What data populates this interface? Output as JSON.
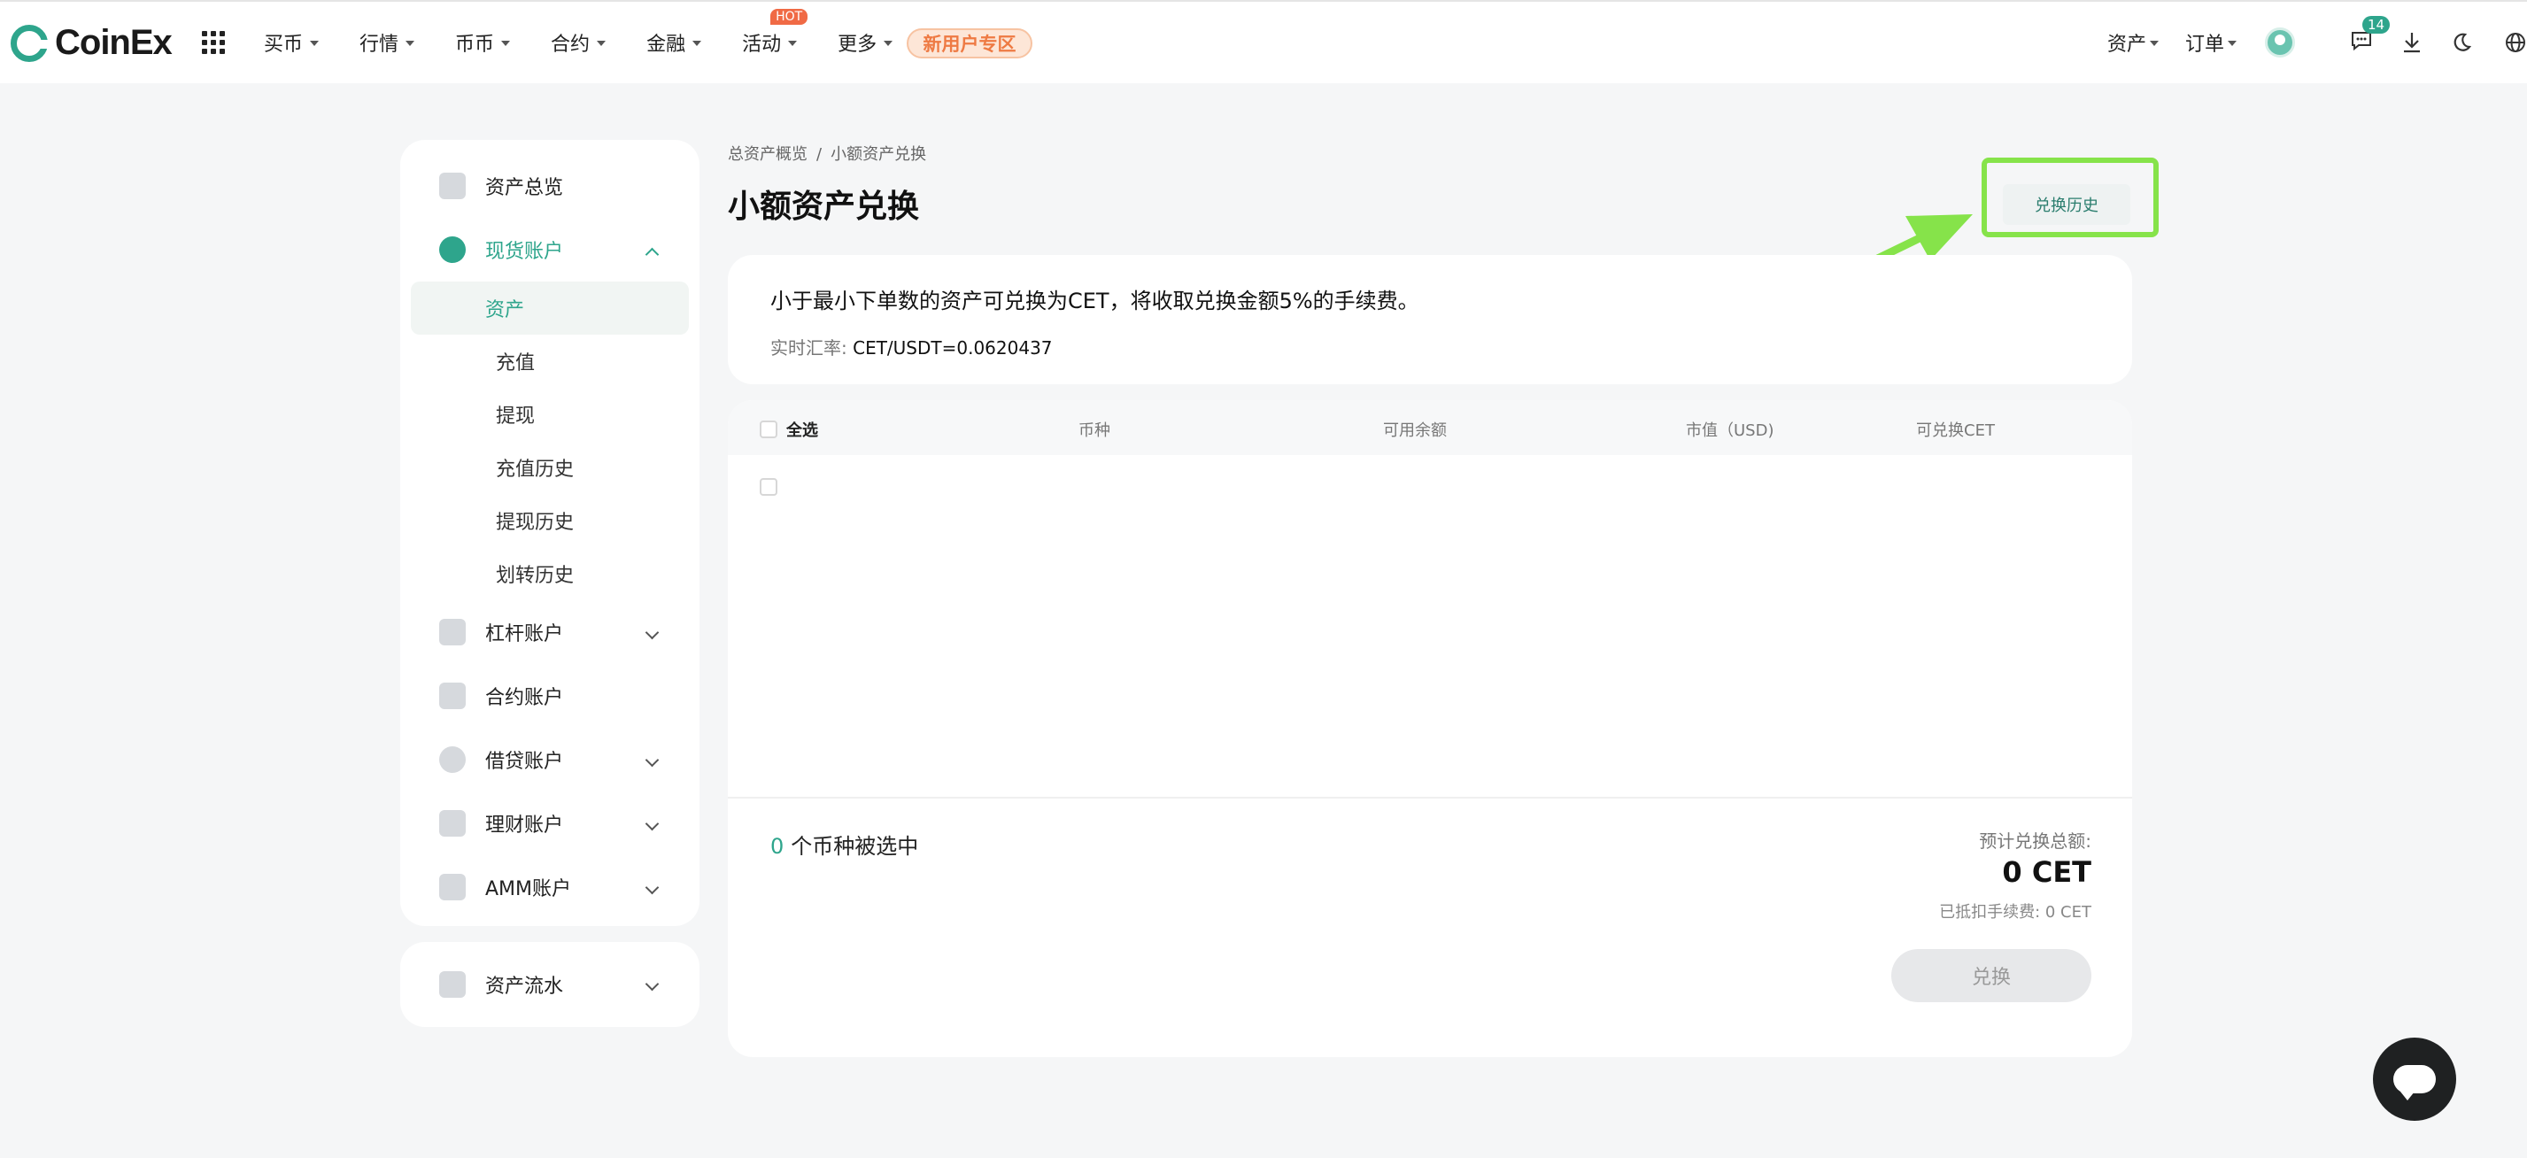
{
  "header": {
    "logo_text": "CoinEx",
    "nav": [
      {
        "label": "买币"
      },
      {
        "label": "行情"
      },
      {
        "label": "币币"
      },
      {
        "label": "合约"
      },
      {
        "label": "金融"
      },
      {
        "label": "活动",
        "badge": "HOT"
      },
      {
        "label": "更多"
      }
    ],
    "new_user": "新用户专区",
    "assets": "资产",
    "orders": "订单",
    "message_count": "14"
  },
  "sidebar": {
    "overview": "资产总览",
    "spot": "现货账户",
    "spot_items": [
      "资产",
      "充值",
      "提现",
      "充值历史",
      "提现历史",
      "划转历史"
    ],
    "margin": "杠杆账户",
    "futures": "合约账户",
    "loan": "借贷账户",
    "finance": "理财账户",
    "amm": "AMM账户",
    "flow": "资产流水"
  },
  "breadcrumb": {
    "parent": "总资产概览",
    "sep": "/",
    "current": "小额资产兑换"
  },
  "page_title": "小额资产兑换",
  "history_button": "兑换历史",
  "info": {
    "description": "小于最小下单数的资产可兑换为CET，将收取兑换金额5%的手续费。",
    "rate_label": "实时汇率:",
    "rate_value": "CET/USDT=0.0620437"
  },
  "table": {
    "select_all": "全选",
    "columns": [
      "币种",
      "可用余额",
      "市值（USD)",
      "可兑换CET"
    ]
  },
  "summary": {
    "count": "0",
    "count_text": "个币种被选中",
    "est_label": "预计兑换总额:",
    "est_value": "0 CET",
    "fee": "已抵扣手续费: 0 CET",
    "exchange_button": "兑换"
  },
  "colors": {
    "accent": "#2ea58c",
    "highlight": "#86e34a"
  }
}
